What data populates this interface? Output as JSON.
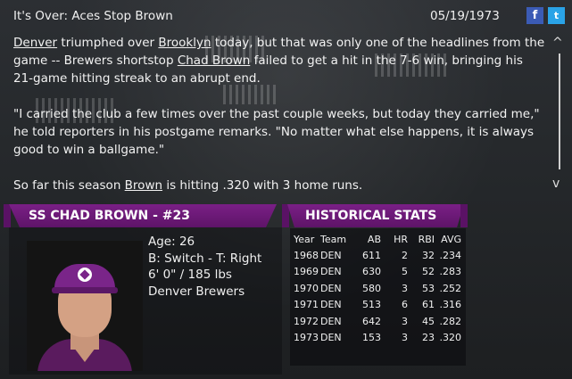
{
  "header": {
    "title": "It's Over: Aces Stop Brown",
    "date": "05/19/1973",
    "facebook_label": "f",
    "twitter_label": "t"
  },
  "article": {
    "p1": {
      "team1": "Denver",
      "t1": " triumphed over ",
      "team2": "Brooklyn",
      "t2": " today, but that was only one of the headlines from the game -- Brewers shortstop ",
      "player": "Chad Brown",
      "t3": " failed to get a hit in the 7-6 win, bringing his 21-game hitting streak to an abrupt end."
    },
    "p2": "\"I carried the club a few times over the past couple weeks, but today they carried me,\" he told reporters in his postgame remarks. \"No matter what else happens, it is always good to win a ballgame.\"",
    "p3": {
      "t1": "So far this season ",
      "player": "Brown",
      "t2": " is hitting .320 with 3 home runs."
    }
  },
  "scroll": {
    "up": "^",
    "down": "v"
  },
  "player_banner": "SS CHAD BROWN - #23",
  "player": {
    "age": "Age: 26",
    "bats_throws": "B: Switch - T: Right",
    "height_weight": "6' 0\" / 185 lbs",
    "team": "Denver Brewers"
  },
  "stats_banner": "HISTORICAL STATS",
  "stats": {
    "columns": [
      "Year",
      "Team",
      "AB",
      "HR",
      "RBI",
      "AVG"
    ],
    "rows": [
      [
        "1968",
        "DEN",
        "611",
        "2",
        "32",
        ".234"
      ],
      [
        "1969",
        "DEN",
        "630",
        "5",
        "52",
        ".283"
      ],
      [
        "1970",
        "DEN",
        "580",
        "3",
        "53",
        ".252"
      ],
      [
        "1971",
        "DEN",
        "513",
        "6",
        "61",
        ".316"
      ],
      [
        "1972",
        "DEN",
        "642",
        "3",
        "45",
        ".282"
      ],
      [
        "1973",
        "DEN",
        "153",
        "3",
        "23",
        ".320"
      ]
    ]
  },
  "colors": {
    "banner": "#6e1a7a",
    "facebook": "#3b5bb5",
    "twitter": "#2aa3e7"
  }
}
